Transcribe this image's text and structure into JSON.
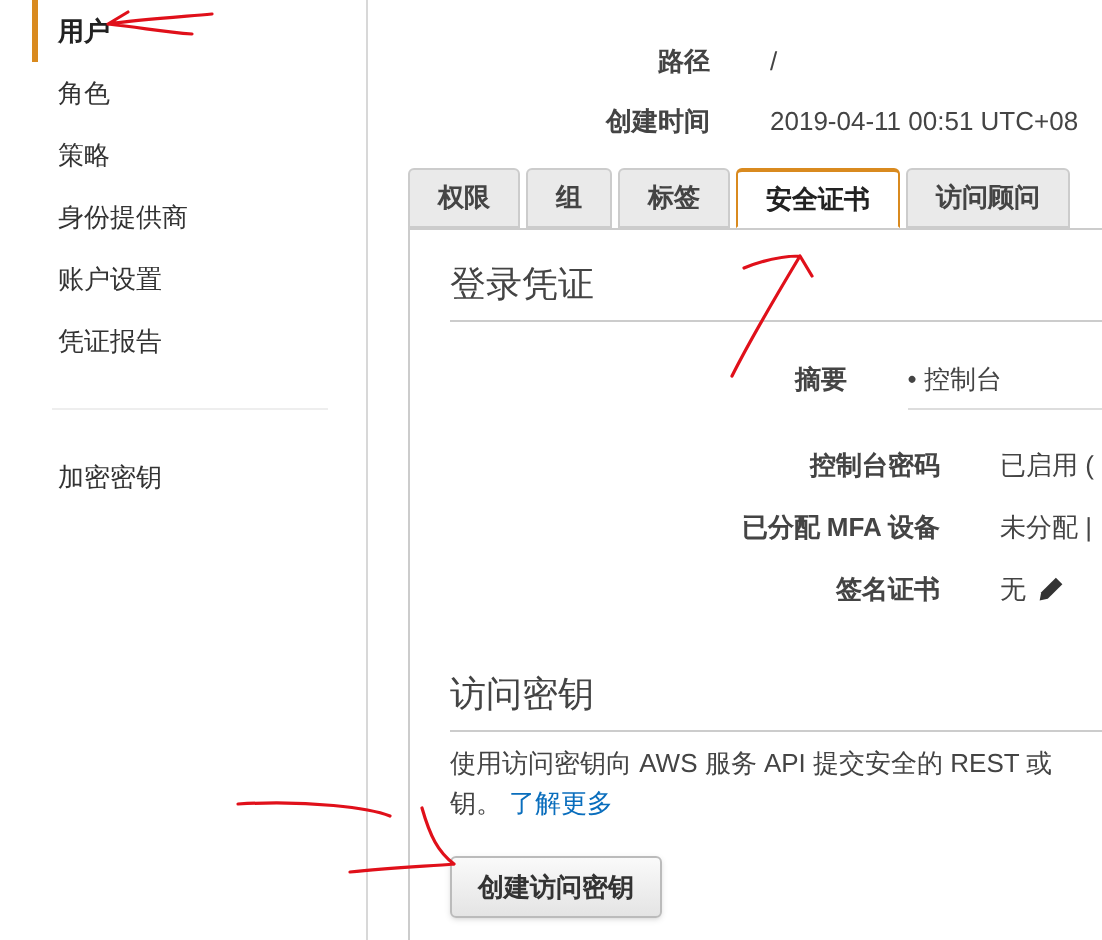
{
  "sidebar": {
    "items": [
      {
        "label": "用户",
        "selected": true
      },
      {
        "label": "角色",
        "selected": false
      },
      {
        "label": "策略",
        "selected": false
      },
      {
        "label": "身份提供商",
        "selected": false
      },
      {
        "label": "账户设置",
        "selected": false
      },
      {
        "label": "凭证报告",
        "selected": false
      }
    ],
    "footer_items": [
      {
        "label": "加密密钥",
        "selected": false
      }
    ]
  },
  "summary": [
    {
      "label": "路径",
      "value": "/"
    },
    {
      "label": "创建时间",
      "value": "2019-04-11 00:51 UTC+08"
    }
  ],
  "tabs": [
    {
      "label": "权限",
      "selected": false
    },
    {
      "label": "组",
      "selected": false
    },
    {
      "label": "标签",
      "selected": false
    },
    {
      "label": "安全证书",
      "selected": true
    },
    {
      "label": "访问顾问",
      "selected": false
    }
  ],
  "sign_in_credentials": {
    "title": "登录凭证",
    "rows": [
      {
        "label": "摘要",
        "value": "• 控制台",
        "kind": "summary"
      },
      {
        "label": "控制台密码",
        "value": "已启用 (",
        "kind": "text"
      },
      {
        "label": "已分配 MFA 设备",
        "value": "未分配 |",
        "kind": "text"
      },
      {
        "label": "签名证书",
        "value": "无",
        "kind": "edit"
      }
    ]
  },
  "access_keys": {
    "title": "访问密钥",
    "description_lines": [
      "使用访问密钥向 AWS 服务 API 提交安全的 REST 或",
      "钥。"
    ],
    "link": "了解更多",
    "button": "创建访问密钥"
  }
}
